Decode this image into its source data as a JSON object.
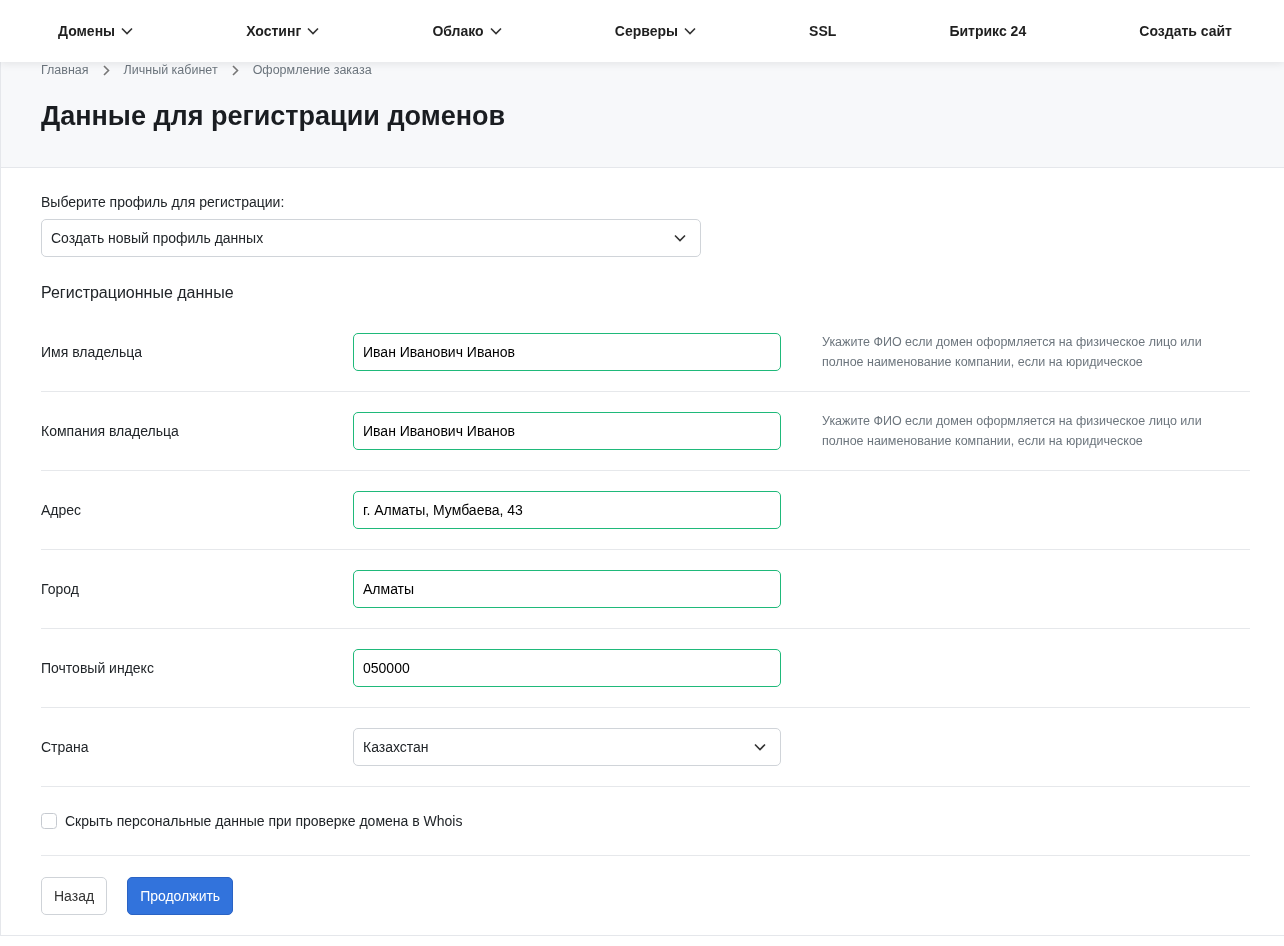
{
  "nav": [
    {
      "label": "Домены",
      "dropdown": true
    },
    {
      "label": "Хостинг",
      "dropdown": true
    },
    {
      "label": "Облако",
      "dropdown": true
    },
    {
      "label": "Серверы",
      "dropdown": true
    },
    {
      "label": "SSL",
      "dropdown": false
    },
    {
      "label": "Битрикс 24",
      "dropdown": false
    },
    {
      "label": "Создать сайт",
      "dropdown": false
    }
  ],
  "breadcrumbs": [
    "Главная",
    "Личный кабинет",
    "Оформление заказа"
  ],
  "title": "Данные для регистрации доменов",
  "profile": {
    "label": "Выберите профиль для регистрации:",
    "value": "Создать новый профиль данных"
  },
  "section_title": "Регистрационные данные",
  "fields": [
    {
      "label": "Имя владельца",
      "kind": "input",
      "value": "Иван Иванович Иванов",
      "valid": true,
      "hint": "Укажите ФИО если домен оформляется на физическое лицо или полное наименование компании, если на юридическое"
    },
    {
      "label": "Компания владельца",
      "kind": "input",
      "value": "Иван Иванович Иванов",
      "valid": true,
      "hint": "Укажите ФИО если домен оформляется на физическое лицо или полное наименование компании, если на юридическое"
    },
    {
      "label": "Адрес",
      "kind": "input",
      "value": "г. Алматы, Мумбаева, 43",
      "valid": true
    },
    {
      "label": "Город",
      "kind": "input",
      "value": "Алматы",
      "valid": true
    },
    {
      "label": "Почтовый индекс",
      "kind": "input",
      "value": "050000",
      "valid": true
    },
    {
      "label": "Страна",
      "kind": "select",
      "value": "Казахстан",
      "valid": false
    }
  ],
  "hide_whois": {
    "label": "Скрыть персональные данные при проверке домена в Whois",
    "checked": false
  },
  "buttons": {
    "back": "Назад",
    "next": "Продолжить"
  }
}
